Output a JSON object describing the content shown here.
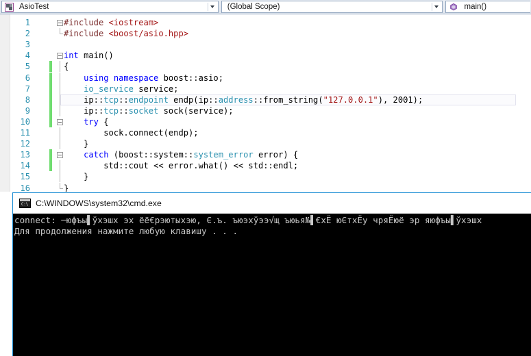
{
  "navbar": {
    "project_selector": {
      "label": "AsioTest",
      "icon": "project-icon",
      "arrow_icon": "chevron-down-icon"
    },
    "scope_selector": {
      "label": "(Global Scope)",
      "arrow_icon": "chevron-down-icon"
    },
    "member_selector": {
      "label": "main()",
      "icon": "method-icon"
    }
  },
  "editor": {
    "lines": [
      {
        "num": "1",
        "indent": 2,
        "changed": false,
        "fold": "open",
        "tokens": [
          {
            "t": "#include ",
            "c": "pp"
          },
          {
            "t": "<iostream>",
            "c": "ppfile"
          }
        ]
      },
      {
        "num": "2",
        "indent": 2,
        "changed": false,
        "fold": "endhook",
        "tokens": [
          {
            "t": "#include ",
            "c": "pp"
          },
          {
            "t": "<boost/asio.hpp>",
            "c": "ppfile"
          }
        ]
      },
      {
        "num": "3",
        "indent": 2,
        "changed": false,
        "fold": "none",
        "tokens": []
      },
      {
        "num": "4",
        "indent": 2,
        "changed": false,
        "fold": "open",
        "tokens": [
          {
            "t": "int",
            "c": "kw"
          },
          {
            "t": " main()",
            "c": "plain"
          }
        ]
      },
      {
        "num": "5",
        "indent": 2,
        "changed": true,
        "fold": "line",
        "tokens": [
          {
            "t": "{",
            "c": "plain"
          }
        ]
      },
      {
        "num": "6",
        "indent": 2,
        "changed": true,
        "fold": "line",
        "tokens": [
          {
            "t": "    ",
            "c": "plain"
          },
          {
            "t": "using",
            "c": "kw"
          },
          {
            "t": " ",
            "c": "plain"
          },
          {
            "t": "namespace",
            "c": "kw"
          },
          {
            "t": " boost::asio;",
            "c": "plain"
          }
        ]
      },
      {
        "num": "7",
        "indent": 2,
        "changed": true,
        "fold": "line",
        "tokens": [
          {
            "t": "    ",
            "c": "plain"
          },
          {
            "t": "io_service",
            "c": "type-t"
          },
          {
            "t": " service;",
            "c": "plain"
          }
        ]
      },
      {
        "num": "8",
        "indent": 2,
        "changed": true,
        "fold": "line",
        "current": true,
        "tokens": [
          {
            "t": "    ip::",
            "c": "plain"
          },
          {
            "t": "tcp",
            "c": "type-t"
          },
          {
            "t": "::",
            "c": "plain"
          },
          {
            "t": "endpoint",
            "c": "type-t"
          },
          {
            "t": " endp(ip::",
            "c": "plain"
          },
          {
            "t": "address",
            "c": "type-t"
          },
          {
            "t": "::from_string(",
            "c": "plain"
          },
          {
            "t": "\"127.0.0.1\"",
            "c": "str"
          },
          {
            "t": "), 2001);",
            "c": "plain"
          }
        ]
      },
      {
        "num": "9",
        "indent": 2,
        "changed": true,
        "fold": "line",
        "tokens": [
          {
            "t": "    ip::",
            "c": "plain"
          },
          {
            "t": "tcp",
            "c": "type-t"
          },
          {
            "t": "::",
            "c": "plain"
          },
          {
            "t": "socket",
            "c": "type-t"
          },
          {
            "t": " sock(service);",
            "c": "plain"
          }
        ]
      },
      {
        "num": "10",
        "indent": 2,
        "changed": true,
        "fold": "open",
        "tokens": [
          {
            "t": "    ",
            "c": "plain"
          },
          {
            "t": "try",
            "c": "kw"
          },
          {
            "t": " {",
            "c": "plain"
          }
        ]
      },
      {
        "num": "11",
        "indent": 2,
        "changed": false,
        "fold": "line",
        "tokens": [
          {
            "t": "        sock.connect(endp);",
            "c": "plain"
          }
        ]
      },
      {
        "num": "12",
        "indent": 2,
        "changed": false,
        "fold": "line",
        "tokens": [
          {
            "t": "    }",
            "c": "plain"
          }
        ]
      },
      {
        "num": "13",
        "indent": 2,
        "changed": true,
        "fold": "open",
        "tokens": [
          {
            "t": "    ",
            "c": "plain"
          },
          {
            "t": "catch",
            "c": "kw"
          },
          {
            "t": " (boost::system::",
            "c": "plain"
          },
          {
            "t": "system_error",
            "c": "type-t"
          },
          {
            "t": " error) {",
            "c": "plain"
          }
        ]
      },
      {
        "num": "14",
        "indent": 2,
        "changed": true,
        "fold": "line",
        "tokens": [
          {
            "t": "        std::cout ",
            "c": "plain"
          },
          {
            "t": "<<",
            "c": "plain"
          },
          {
            "t": " error.what() ",
            "c": "plain"
          },
          {
            "t": "<<",
            "c": "plain"
          },
          {
            "t": " std::endl;",
            "c": "plain"
          }
        ]
      },
      {
        "num": "15",
        "indent": 2,
        "changed": false,
        "fold": "line",
        "tokens": [
          {
            "t": "    }",
            "c": "plain"
          }
        ]
      },
      {
        "num": "16",
        "indent": 2,
        "changed": false,
        "fold": "endhook",
        "tokens": [
          {
            "t": "}",
            "c": "plain"
          }
        ]
      }
    ]
  },
  "console": {
    "title": "C:\\WINDOWS\\system32\\cmd.exe",
    "icon": "cmd-icon",
    "icon_glyph": "C:\\",
    "lines": [
      "connect: ─юфъы▌ўхэшх эх ёё€рэютыхэю, Є.ъ. ъюэхўээ√щ ъюья№▌€хЁ юЄтхЁу чряЁюё эр яюфъы▌ўхэшх",
      "Для продолжения нажмите любую клавишу . . ."
    ]
  },
  "colors": {
    "keyword": "#0000ff",
    "type": "#2b91af",
    "string": "#a31515",
    "preprocessor": "#7b2d2d",
    "line_number": "#2b91af",
    "change_bar": "#70dd70",
    "console_bg": "#000000",
    "console_fg": "#c8c8c8",
    "window_border": "#1a8cd4"
  }
}
